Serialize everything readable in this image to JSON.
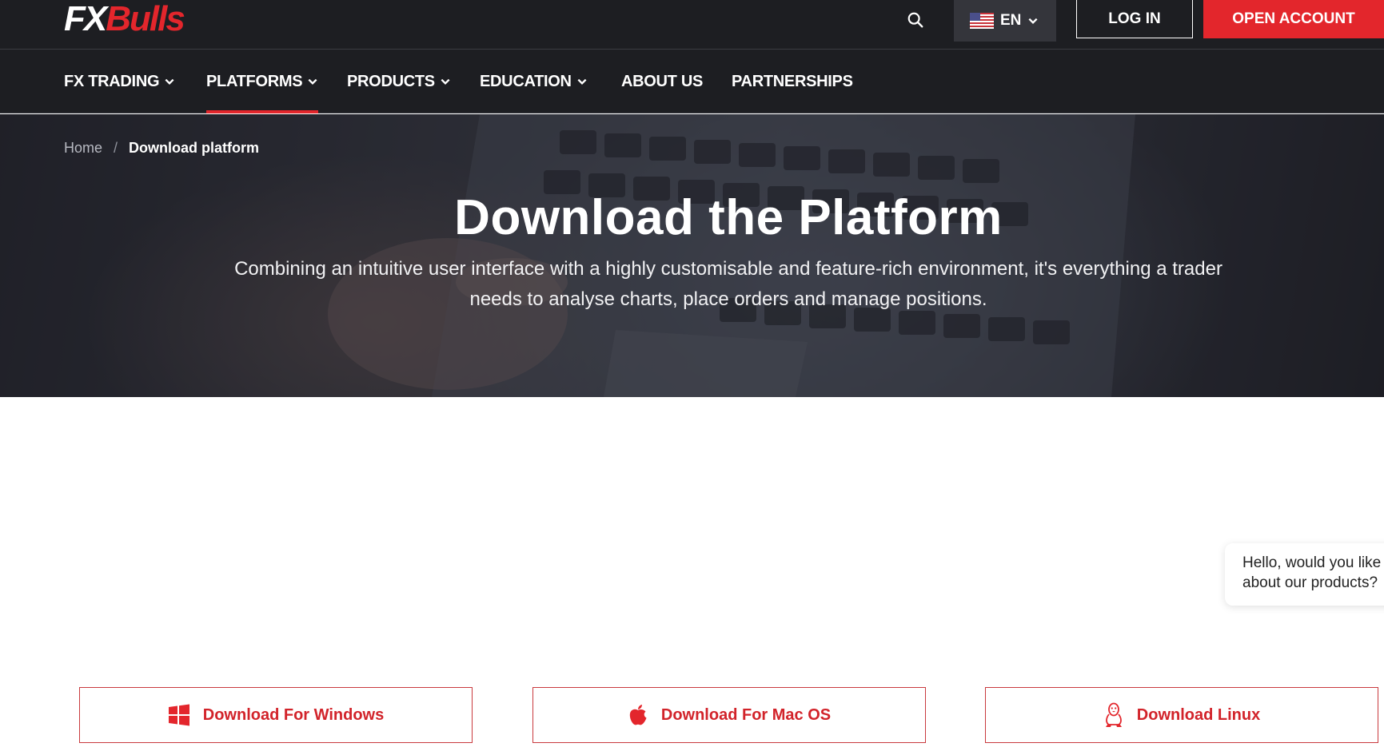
{
  "brand": {
    "logo_fx": "FX",
    "logo_bulls": "Bulls",
    "accent_color": "#e3262c",
    "dark_bg": "#1d1e22"
  },
  "header": {
    "search_icon": "search-icon",
    "language": {
      "code": "EN",
      "flag": "us-flag-icon"
    },
    "login_label": "LOG IN",
    "open_account_label": "OPEN ACCOUNT"
  },
  "nav": {
    "items": [
      {
        "label": "FX TRADING",
        "has_dropdown": true,
        "active": false
      },
      {
        "label": "PLATFORMS",
        "has_dropdown": true,
        "active": true
      },
      {
        "label": "PRODUCTS",
        "has_dropdown": true,
        "active": false
      },
      {
        "label": "EDUCATION",
        "has_dropdown": true,
        "active": false
      },
      {
        "label": "ABOUT US",
        "has_dropdown": false,
        "active": false
      },
      {
        "label": "PARTNERSHIPS",
        "has_dropdown": false,
        "active": false
      }
    ]
  },
  "breadcrumb": {
    "home": "Home",
    "separator": "/",
    "current": "Download platform"
  },
  "hero": {
    "title": "Download the Platform",
    "subtitle_line1": "Combining an intuitive user interface with a highly customisable and feature-rich environment, it's everything a trader",
    "subtitle_line2": "needs to analyse charts, place orders and manage positions."
  },
  "chat": {
    "line1": "Hello, would you like",
    "line2": "about our products?"
  },
  "downloads": {
    "windows": {
      "label": "Download For Windows",
      "icon": "windows-icon"
    },
    "mac": {
      "label": "Download For Mac OS",
      "icon": "apple-icon"
    },
    "linux": {
      "label": "Download Linux",
      "icon": "linux-icon"
    }
  }
}
